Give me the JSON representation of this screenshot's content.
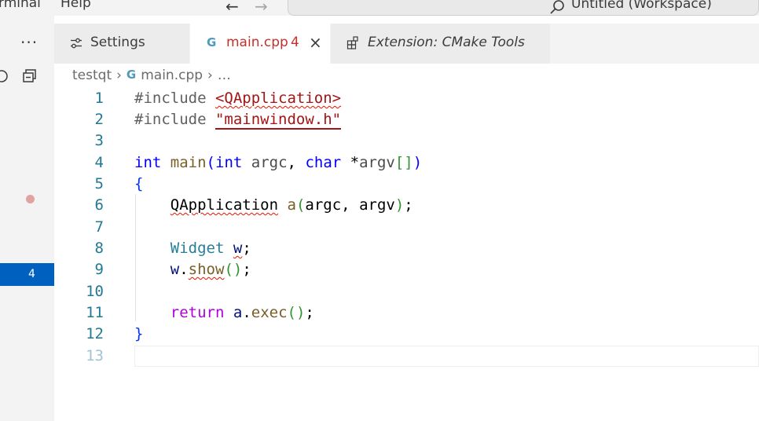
{
  "menu": {
    "terminal": "rminal",
    "help": "Help"
  },
  "nav": {
    "back_glyph": "←",
    "forward_glyph": "→"
  },
  "command_center": {
    "label": "Untitled (Workspace)"
  },
  "sidebar": {
    "more_label": "···",
    "problem_count": "4"
  },
  "tabs": [
    {
      "label": "Settings",
      "icon": "settings-sliders-icon"
    },
    {
      "label": "main.cpp",
      "badge": "4",
      "icon": "c-plus-plus-icon",
      "close": "×",
      "active": true
    },
    {
      "label": "Extension: CMake Tools",
      "icon": "extension-icon"
    }
  ],
  "breadcrumb": {
    "folder": "testqt",
    "file": "main.cpp",
    "more": "…",
    "sep": "›"
  },
  "editor": {
    "language_icon": "G",
    "line_numbers": [
      "1",
      "2",
      "3",
      "4",
      "5",
      "6",
      "7",
      "8",
      "9",
      "10",
      "11",
      "12",
      "13"
    ],
    "line1": {
      "directive": "#include ",
      "header": "<QApplication>"
    },
    "line2": {
      "directive": "#include ",
      "header": "\"mainwindow.h\""
    },
    "line4": {
      "int1": "int",
      "main": "main",
      "open": "(",
      "int2": "int",
      "argc": "argc",
      "comma": ", ",
      "char": "char",
      "star": " *",
      "argv": "argv",
      "brackets": "[]",
      "close": ")"
    },
    "line5": {
      "brace": "{"
    },
    "line6": {
      "type": "QApplication",
      "a": "a",
      "open": "(",
      "argc": "argc",
      "comma": ", ",
      "argv": "argv",
      "close": ")",
      "semi": ";"
    },
    "line8": {
      "type": "Widget",
      "w": "w",
      "semi": ";"
    },
    "line9": {
      "w": "w",
      "dot": ".",
      "show": "show",
      "parens": "()",
      "semi": ";"
    },
    "line11": {
      "ret": "return",
      "a": "a",
      "dot": ".",
      "exec": "exec",
      "parens": "()",
      "semi": ";"
    },
    "line12": {
      "brace": "}"
    }
  },
  "colors": {
    "accent": "#0060c0",
    "error": "#e51400",
    "line_number": "#237893"
  }
}
